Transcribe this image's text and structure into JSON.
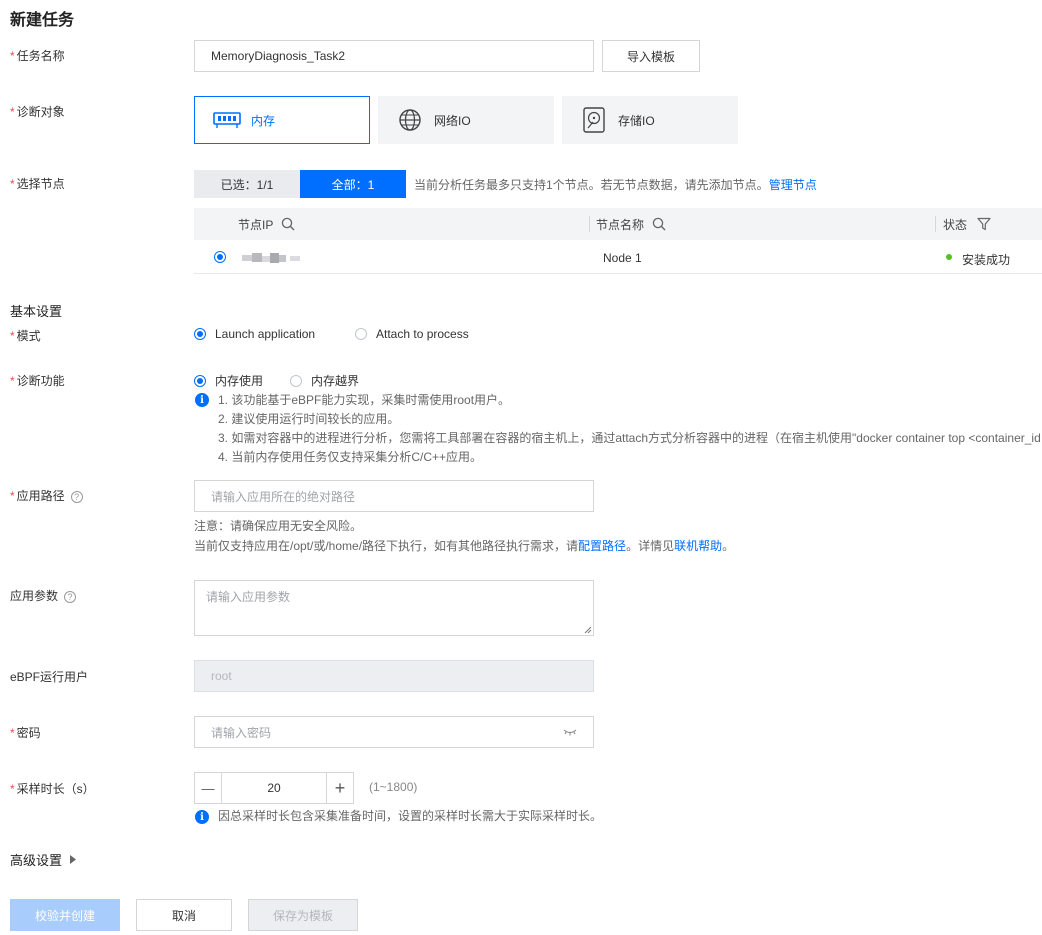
{
  "page": {
    "title": "新建任务"
  },
  "task_name": {
    "label": "任务名称",
    "value": "MemoryDiagnosis_Task2",
    "import_btn": "导入模板"
  },
  "target": {
    "label": "诊断对象",
    "options": [
      "内存",
      "网络IO",
      "存储IO"
    ],
    "selected": "内存"
  },
  "nodes": {
    "label": "选择节点",
    "tab_selected": "已选：1/1",
    "tab_all": "全部：1",
    "hint": "当前分析任务最多只支持1个节点。若无节点数据，请先添加节点。",
    "hint_link": "管理节点",
    "columns": [
      "节点IP",
      "节点名称",
      "状态"
    ],
    "rows": [
      {
        "name": "Node 1",
        "status": "安装成功"
      }
    ],
    "status_color": "#52c41a"
  },
  "basic": {
    "title": "基本设置"
  },
  "mode": {
    "label": "模式",
    "options": [
      "Launch application",
      "Attach to process"
    ],
    "selected": "Launch application"
  },
  "feature": {
    "label": "诊断功能",
    "options": [
      "内存使用",
      "内存越界"
    ],
    "selected": "内存使用",
    "notes": [
      "1. 该功能基于eBPF能力实现，采集时需使用root用户。",
      "2. 建议使用运行时间较长的应用。",
      "3. 如需对容器中的进程进行分析，您需将工具部署在容器的宿主机上，通过attach方式分析容器中的进程（在宿主机使用\"docker container top <container_id",
      "4. 当前内存使用任务仅支持采集分析C/C++应用。"
    ]
  },
  "app_path": {
    "label": "应用路径",
    "placeholder": "请输入应用所在的绝对路径",
    "note1": "注意：请确保应用无安全风险。",
    "note2_pre": "当前仅支持应用在/opt/或/home/路径下执行，如有其他路径执行需求，请",
    "note2_link1": "配置路径",
    "note2_mid": "。详情见",
    "note2_link2": "联机帮助",
    "note2_end": "。"
  },
  "app_args": {
    "label": "应用参数",
    "placeholder": "请输入应用参数"
  },
  "ebpf_user": {
    "label": "eBPF运行用户",
    "value": "root"
  },
  "password": {
    "label": "密码",
    "placeholder": "请输入密码"
  },
  "duration": {
    "label": "采样时长（s）",
    "value": "20",
    "minus": "—",
    "plus": "+",
    "range": "(1~1800)",
    "note": "因总采样时长包含采集准备时间，设置的采样时长需大于实际采样时长。"
  },
  "advanced": {
    "label": "高级设置"
  },
  "actions": {
    "create": "校验并创建",
    "cancel": "取消",
    "save_template": "保存为模板"
  },
  "colors": {
    "accent": "#006eff",
    "required": "#e34d59",
    "disabled_btn": "#a8cdfc"
  }
}
